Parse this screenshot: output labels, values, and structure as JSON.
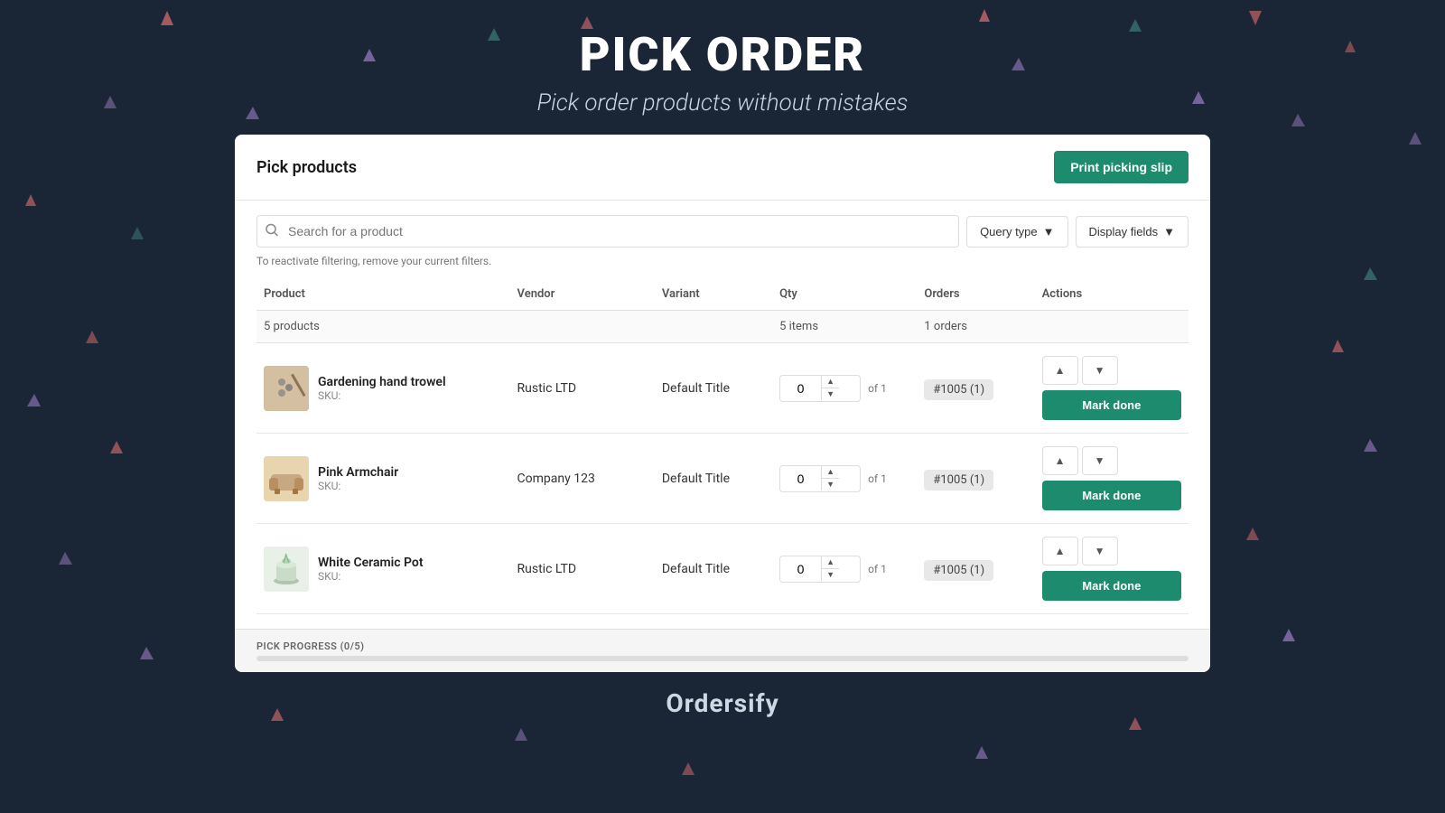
{
  "background": {
    "color": "#1a2535"
  },
  "header": {
    "title": "PICK ORDER",
    "subtitle": "Pick order products without mistakes"
  },
  "card": {
    "title": "Pick products",
    "print_button": "Print picking slip"
  },
  "search": {
    "placeholder": "Search for a product",
    "filter_hint": "To reactivate filtering, remove your current filters.",
    "query_type_label": "Query type",
    "display_fields_label": "Display fields"
  },
  "table": {
    "columns": [
      "Product",
      "Vendor",
      "Variant",
      "Qty",
      "Orders",
      "Actions"
    ],
    "summary": {
      "product_count": "5 products",
      "qty_total": "5 items",
      "orders_total": "1 orders"
    },
    "rows": [
      {
        "name": "Gardening hand trowel",
        "sku": "SKU:",
        "vendor": "Rustic LTD",
        "variant": "Default Title",
        "qty_current": "0",
        "qty_of": "of 1",
        "order": "#1005 (1)",
        "mark_done": "Mark done",
        "thumb_type": "trowel"
      },
      {
        "name": "Pink Armchair",
        "sku": "SKU:",
        "vendor": "Company 123",
        "variant": "Default Title",
        "qty_current": "0",
        "qty_of": "of 1",
        "order": "#1005 (1)",
        "mark_done": "Mark done",
        "thumb_type": "armchair"
      },
      {
        "name": "White Ceramic Pot",
        "sku": "SKU:",
        "vendor": "Rustic LTD",
        "variant": "Default Title",
        "qty_current": "0",
        "qty_of": "of 1",
        "order": "#1005 (1)",
        "mark_done": "Mark done",
        "thumb_type": "pot"
      }
    ]
  },
  "footer": {
    "progress_label": "PICK PROGRESS (0/5)",
    "progress_percent": 0
  },
  "brand": {
    "name": "Ordersify"
  }
}
